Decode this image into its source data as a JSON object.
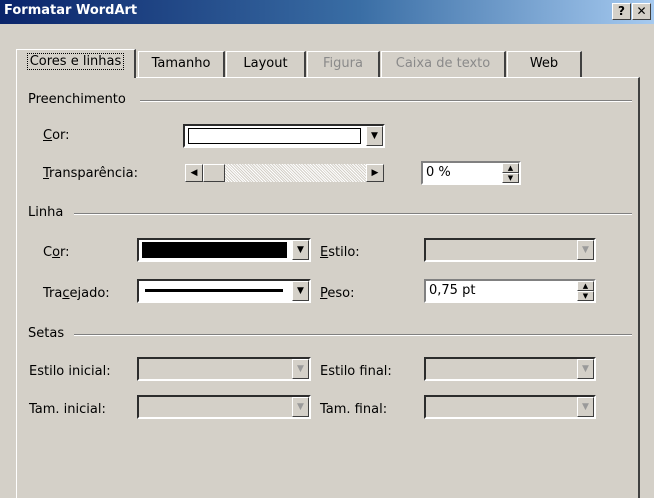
{
  "window": {
    "title": "Formatar WordArt",
    "help_label": "?",
    "close_label": "✕"
  },
  "tabs": [
    {
      "label": "Cores e linhas",
      "state": "active"
    },
    {
      "label": "Tamanho",
      "state": "enabled"
    },
    {
      "label": "Layout",
      "state": "enabled"
    },
    {
      "label": "Figura",
      "state": "disabled"
    },
    {
      "label": "Caixa de texto",
      "state": "disabled"
    },
    {
      "label": "Web",
      "state": "enabled"
    }
  ],
  "fill": {
    "group_label": "Preenchimento",
    "color_label": "Cor:",
    "color_value": "#ffffff",
    "transparency_label": "Transparência:",
    "transparency_value": "0 %",
    "transparency_slider_fraction": 0.0
  },
  "line": {
    "group_label": "Linha",
    "color_label": "Cor:",
    "color_value": "#000000",
    "dash_label": "Tracejado:",
    "style_label": "Estilo:",
    "weight_label": "Peso:",
    "weight_value": "0,75 pt"
  },
  "arrows": {
    "group_label": "Setas",
    "begin_style_label": "Estilo inicial:",
    "end_style_label": "Estilo final:",
    "begin_size_label": "Tam. inicial:",
    "end_size_label": "Tam. final:"
  },
  "icons": {
    "dropdown": "▼",
    "spin_up": "▲",
    "spin_down": "▼",
    "scroll_left": "◀",
    "scroll_right": "▶"
  }
}
